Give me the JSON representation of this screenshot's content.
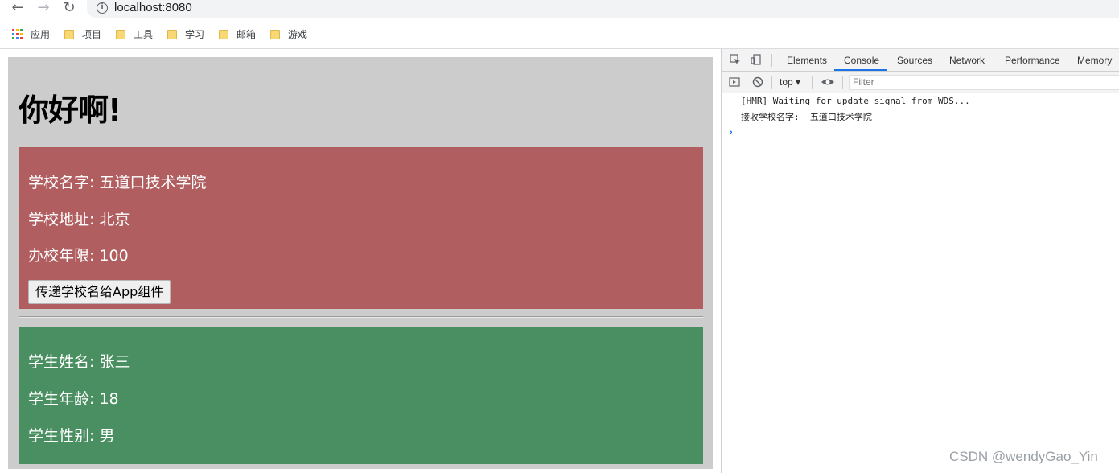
{
  "browser": {
    "url": "localhost:8080",
    "bookmarks": [
      {
        "label": "应用",
        "icon": "apps-grid-icon"
      },
      {
        "label": "项目",
        "icon": "folder-icon"
      },
      {
        "label": "工具",
        "icon": "folder-icon"
      },
      {
        "label": "学习",
        "icon": "folder-icon"
      },
      {
        "label": "邮箱",
        "icon": "folder-icon"
      },
      {
        "label": "游戏",
        "icon": "folder-icon"
      }
    ]
  },
  "page": {
    "title": "你好啊!",
    "school": {
      "name_line": "学校名字: 五道口技术学院",
      "address_line": "学校地址: 北京",
      "years_line": "办校年限: 100",
      "button_label": "传递学校名给App组件",
      "background": "#b05e60"
    },
    "student": {
      "name_line": "学生姓名: 张三",
      "age_line": "学生年龄: 18",
      "gender_line": "学生性别: 男",
      "background": "#4a8f61"
    }
  },
  "devtools": {
    "tabs": [
      "Elements",
      "Console",
      "Sources",
      "Network",
      "Performance",
      "Memory"
    ],
    "active_tab": "Console",
    "context": "top",
    "filter_placeholder": "Filter",
    "console_logs": [
      "[HMR] Waiting for update signal from WDS...",
      "接收学校名字:  五道口技术学院"
    ]
  },
  "watermark": "CSDN @wendyGao_Yin"
}
